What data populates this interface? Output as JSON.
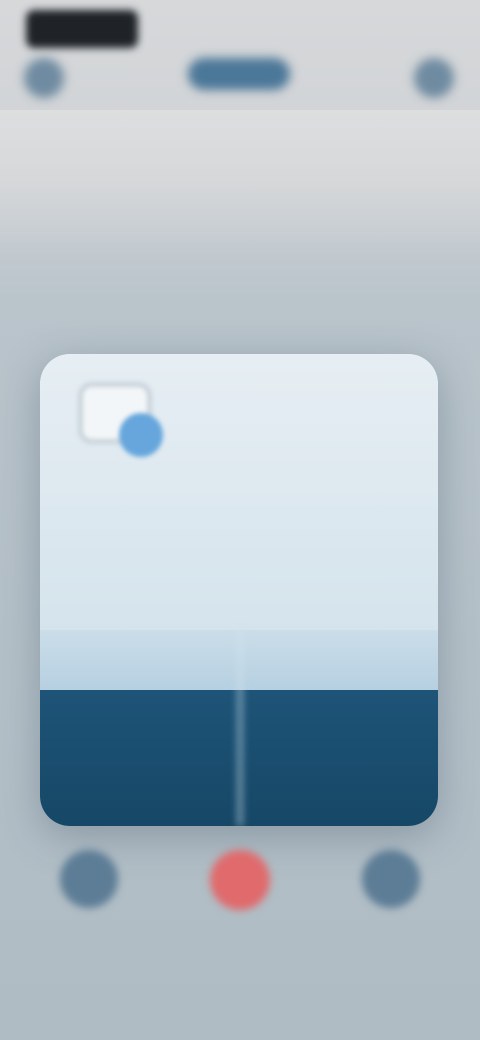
{
  "status_bar": {
    "time": ""
  },
  "header": {
    "title": ""
  },
  "dialog": {
    "title": "",
    "body": "",
    "choices": {
      "left": "",
      "right": ""
    },
    "actions": {
      "left": "",
      "right": ""
    }
  },
  "colors": {
    "accent": "#1e5478",
    "primary_button": "#4b7798",
    "end_button": "#e06a6c",
    "badge": "#66a6dc"
  },
  "icons": {
    "back": "chevron-left-icon",
    "more": "more-icon",
    "app": "app-icon",
    "mute": "mute-icon",
    "end_call": "end-call-icon",
    "speaker": "speaker-icon"
  }
}
